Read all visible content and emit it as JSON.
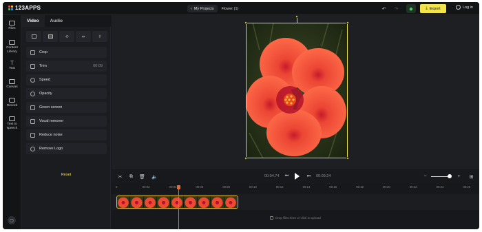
{
  "app": {
    "logo_text": "123APPS"
  },
  "header": {
    "my_projects_label": "My Projects",
    "project_title": "Flower (1)",
    "export_label": "Export",
    "login_label": "Log in"
  },
  "rail": {
    "items": [
      {
        "label": "Files",
        "icon": "folder-icon"
      },
      {
        "label": "Content Library",
        "icon": "library-icon"
      },
      {
        "label": "Text",
        "icon": "text-icon"
      },
      {
        "label": "Canvas",
        "icon": "canvas-icon"
      },
      {
        "label": "Record",
        "icon": "record-icon"
      },
      {
        "label": "Text to speech",
        "icon": "speech-icon"
      }
    ]
  },
  "panel": {
    "tabs": [
      "Video",
      "Audio"
    ],
    "active_tab": "Video",
    "quick_actions": [
      "fit-icon",
      "fill-icon",
      "rotate-icon",
      "flip-horizontal-icon",
      "flip-vertical-icon"
    ],
    "tools": [
      {
        "label": "Crop",
        "icon": "crop-icon",
        "value": ""
      },
      {
        "label": "Trim",
        "icon": "trim-icon",
        "value": "00:09"
      },
      {
        "label": "Speed",
        "icon": "speed-icon",
        "value": ""
      },
      {
        "label": "Opacity",
        "icon": "opacity-icon",
        "value": ""
      },
      {
        "label": "Green screen",
        "icon": "green-screen-icon",
        "value": ""
      },
      {
        "label": "Vocal remover",
        "icon": "vocal-remover-icon",
        "value": ""
      },
      {
        "label": "Reduce noise",
        "icon": "reduce-noise-icon",
        "value": ""
      },
      {
        "label": "Remove Logo",
        "icon": "remove-logo-icon",
        "value": ""
      }
    ],
    "reset_label": "Reset"
  },
  "player": {
    "current_time": "00:04.74",
    "total_time": "00:09.24",
    "zoom_level": 0.85
  },
  "timeline": {
    "ticks": [
      "0",
      "00:02",
      "00:04",
      "00:06",
      "00:08",
      "00:10",
      "00:12",
      "00:14",
      "00:16",
      "00:18",
      "00:20",
      "00:22",
      "00:24",
      "00:26"
    ],
    "drop_hint": "Drop files here or click to upload",
    "clip_thumbnails": 9
  },
  "colors": {
    "accent": "#f2e54b",
    "playhead": "#f0672c",
    "background": "#17181b"
  }
}
